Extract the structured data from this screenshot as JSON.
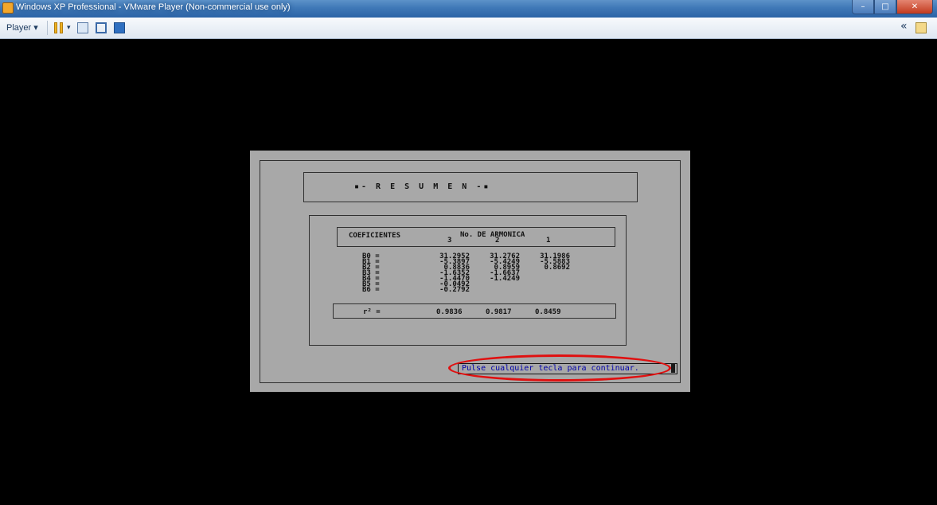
{
  "window": {
    "title": "Windows XP Professional - VMware Player (Non-commercial use only)",
    "minimize": "–",
    "maximize": "□",
    "close": "✕"
  },
  "toolbar": {
    "player_menu": "Player ▾",
    "dropdown_arrow": "▾",
    "back_label": "«"
  },
  "resumen": {
    "title": "▪- R E S U M E N -▪"
  },
  "coef_table": {
    "header_coef": "COEFICIENTES",
    "header_harmonic": "No. DE ARMONICA",
    "harmonic_numbers": [
      "3",
      "2",
      "1"
    ],
    "labels": "B0 =\nB1 =\nB2 =\nB3 =\nB4 =\nB5 =\nB6 =",
    "col3": "31.2952\n-5.3897\n0.8836\n-1.6352\n-1.4470\n-0.0492\n-0.2792",
    "col2": "31.2762\n-5.4249\n0.8959\n-1.6637\n-1.4249",
    "col1": "31.1986\n-5.5883\n0.8692",
    "r2_label": "r² =",
    "r2_values": [
      "0.9836",
      "0.9817",
      "0.8459"
    ]
  },
  "prompt": {
    "continue": "Pulse cualquier tecla para continuar."
  },
  "colors": {
    "dialog_bg": "#a8a8a8",
    "prompt_text": "#0000aa",
    "highlight": "#e01010"
  }
}
